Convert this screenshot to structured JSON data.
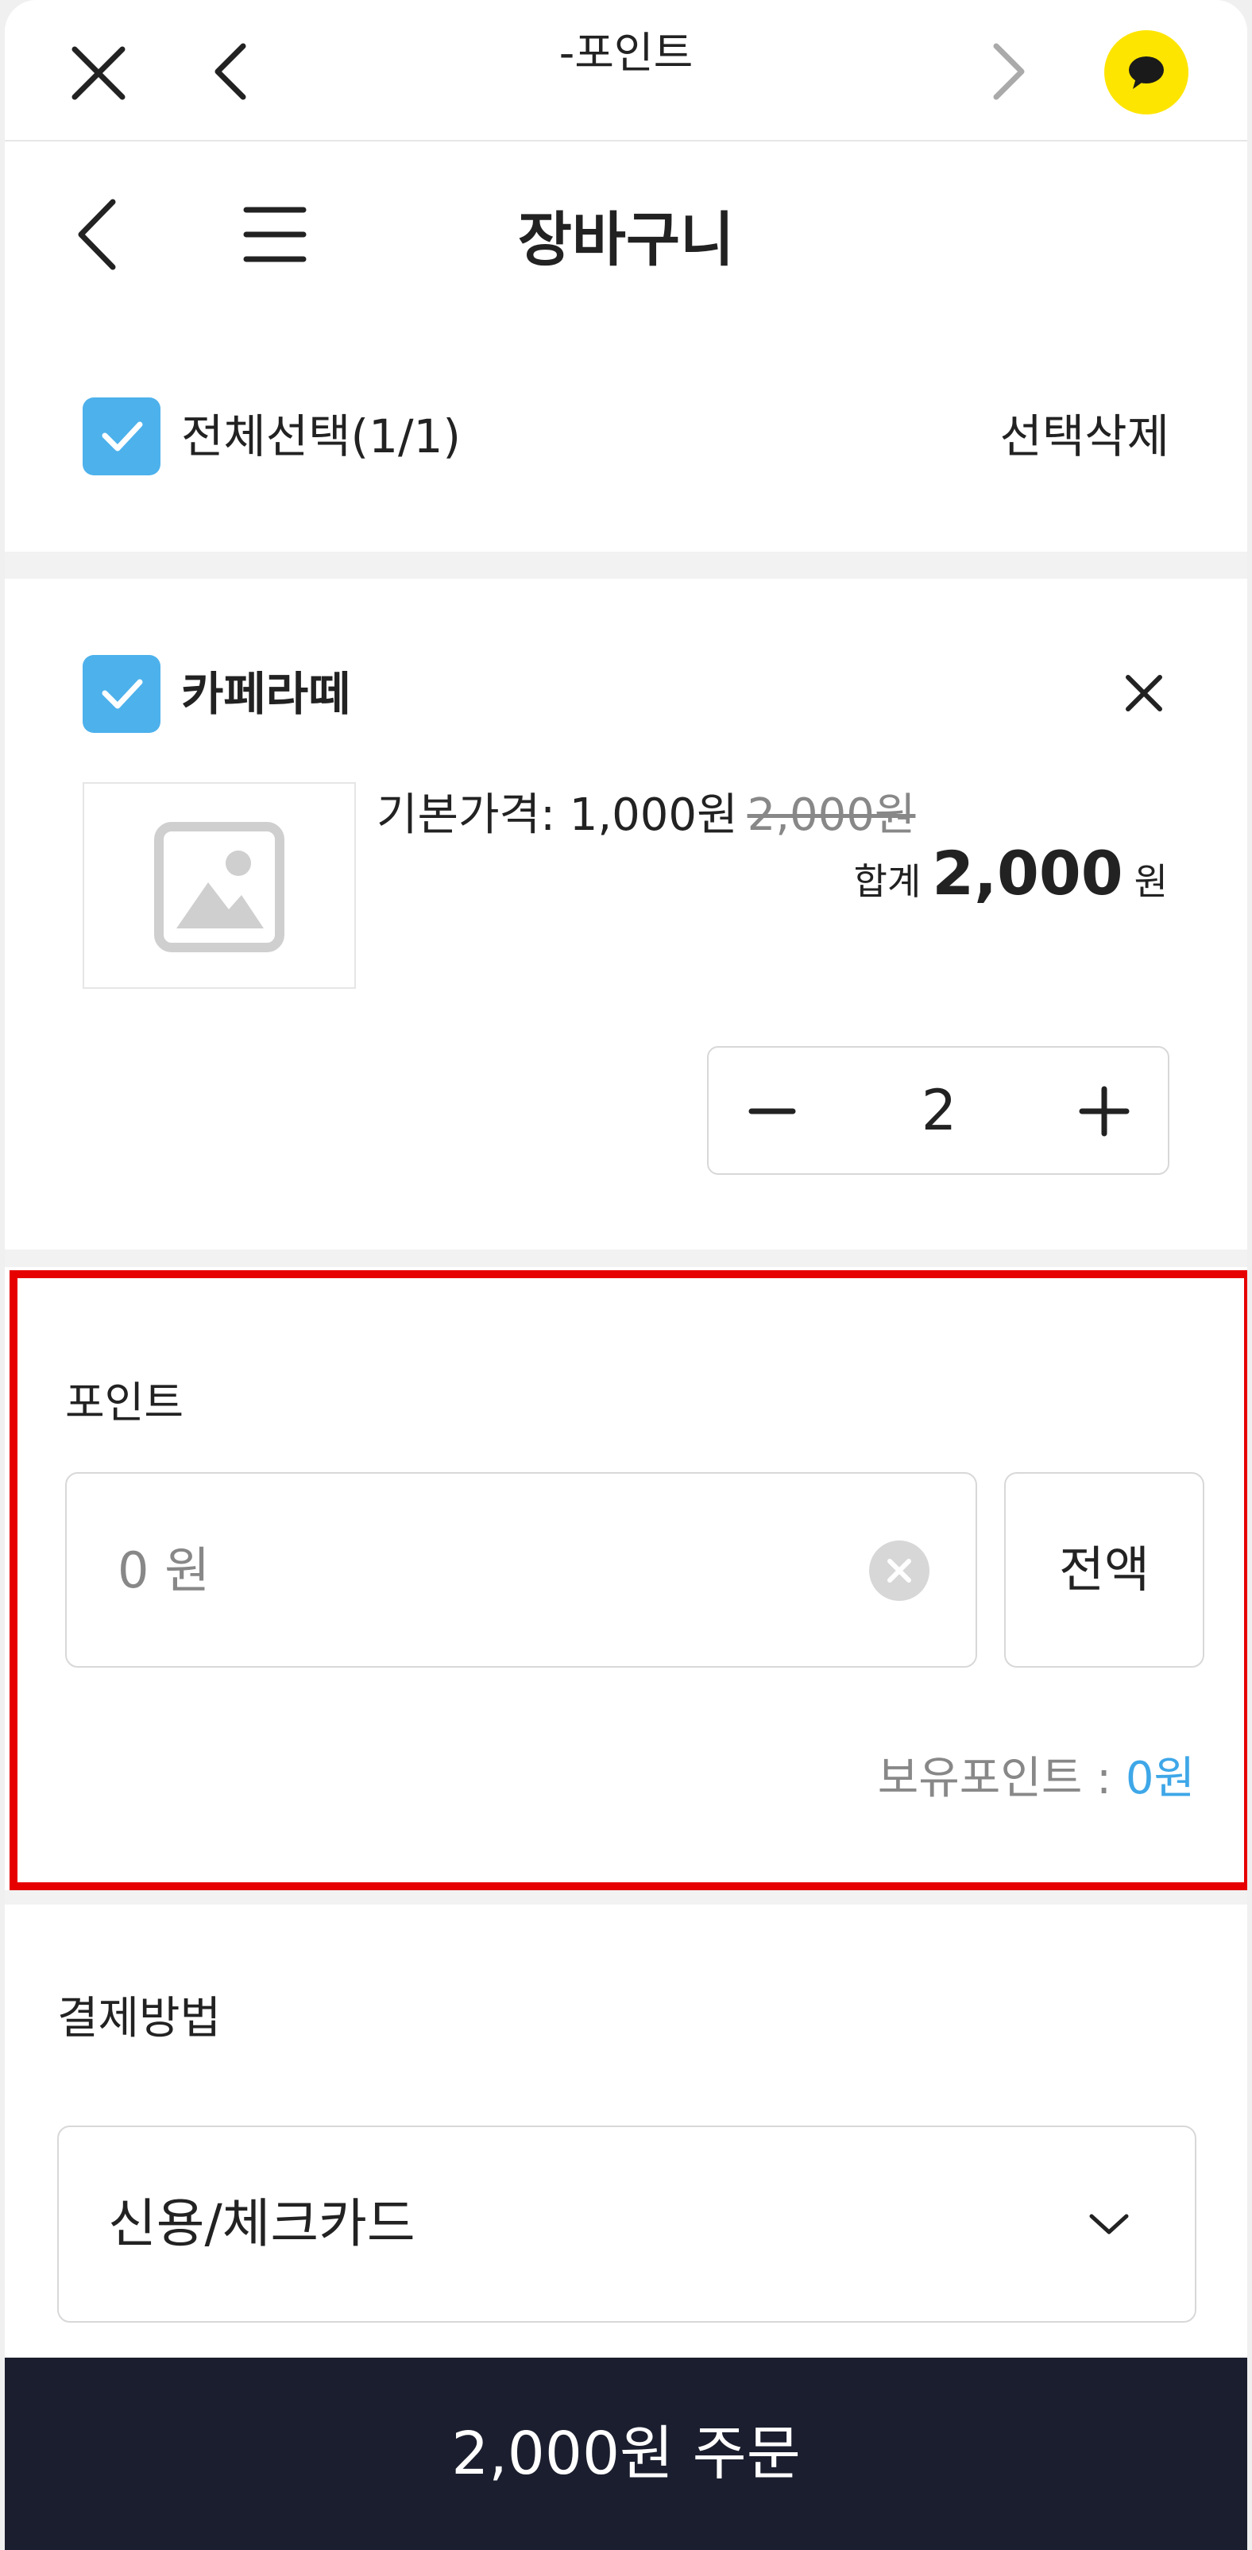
{
  "browser": {
    "title": "-포인트"
  },
  "header": {
    "title": "장바구니"
  },
  "cart": {
    "select_all_label": "전체선택(1/1)",
    "delete_selected_label": "선택삭제",
    "select_all_checked": true
  },
  "item": {
    "name": "카페라떼",
    "checked": true,
    "base_price_label": "기본가격: 1,000원",
    "original_price": "2,000원",
    "total_label": "합계",
    "total_amount": "2,000",
    "total_unit": "원",
    "quantity": "2"
  },
  "points": {
    "label": "포인트",
    "input_value": "",
    "input_placeholder": "0 원",
    "use_all_label": "전액",
    "held_label": "보유포인트 : ",
    "held_value": "0원"
  },
  "payment": {
    "label": "결제방법",
    "selected": "신용/체크카드"
  },
  "order_button_label": "2,000원 주문",
  "colors": {
    "accent": "#4db1ec",
    "kakao_yellow": "#fee500",
    "order_button": "#1b1e2e",
    "highlight_border": "#e60000",
    "points_value": "#3ea7e8"
  }
}
